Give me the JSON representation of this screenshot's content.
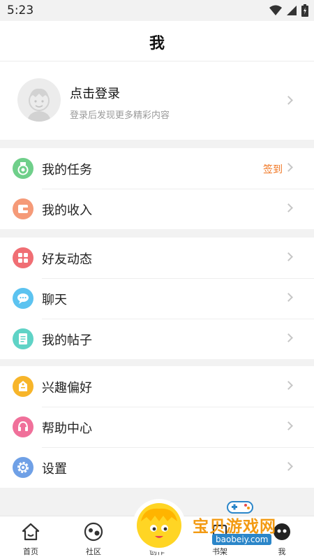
{
  "status": {
    "time": "5:23"
  },
  "header": {
    "title": "我"
  },
  "profile": {
    "title": "点击登录",
    "subtitle": "登录后发现更多精彩内容"
  },
  "groups": [
    {
      "items": [
        {
          "label": "我的任务",
          "icon": "medal-icon",
          "color": "#6fcf8a",
          "badge": "签到"
        },
        {
          "label": "我的收入",
          "icon": "wallet-icon",
          "color": "#f59a78"
        }
      ]
    },
    {
      "items": [
        {
          "label": "好友动态",
          "icon": "grid-icon",
          "color": "#f06e74"
        },
        {
          "label": "聊天",
          "icon": "chat-icon",
          "color": "#5cc3f0"
        },
        {
          "label": "我的帖子",
          "icon": "document-icon",
          "color": "#5fd3c6"
        }
      ]
    },
    {
      "items": [
        {
          "label": "兴趣偏好",
          "icon": "tag-icon",
          "color": "#f7b52a"
        },
        {
          "label": "帮助中心",
          "icon": "headset-icon",
          "color": "#f0709a"
        },
        {
          "label": "设置",
          "icon": "gear-icon",
          "color": "#6fa0e6"
        }
      ]
    }
  ],
  "bottom_nav": {
    "items": [
      {
        "label": "首页",
        "icon": "home-icon"
      },
      {
        "label": "社区",
        "icon": "community-icon"
      },
      {
        "label": "创作",
        "icon": "create-icon"
      },
      {
        "label": "书架",
        "icon": "bookshelf-icon"
      },
      {
        "label": "我",
        "icon": "me-icon"
      }
    ]
  },
  "watermark": {
    "text": "宝贝游戏网",
    "url": "baobeiy.com"
  }
}
